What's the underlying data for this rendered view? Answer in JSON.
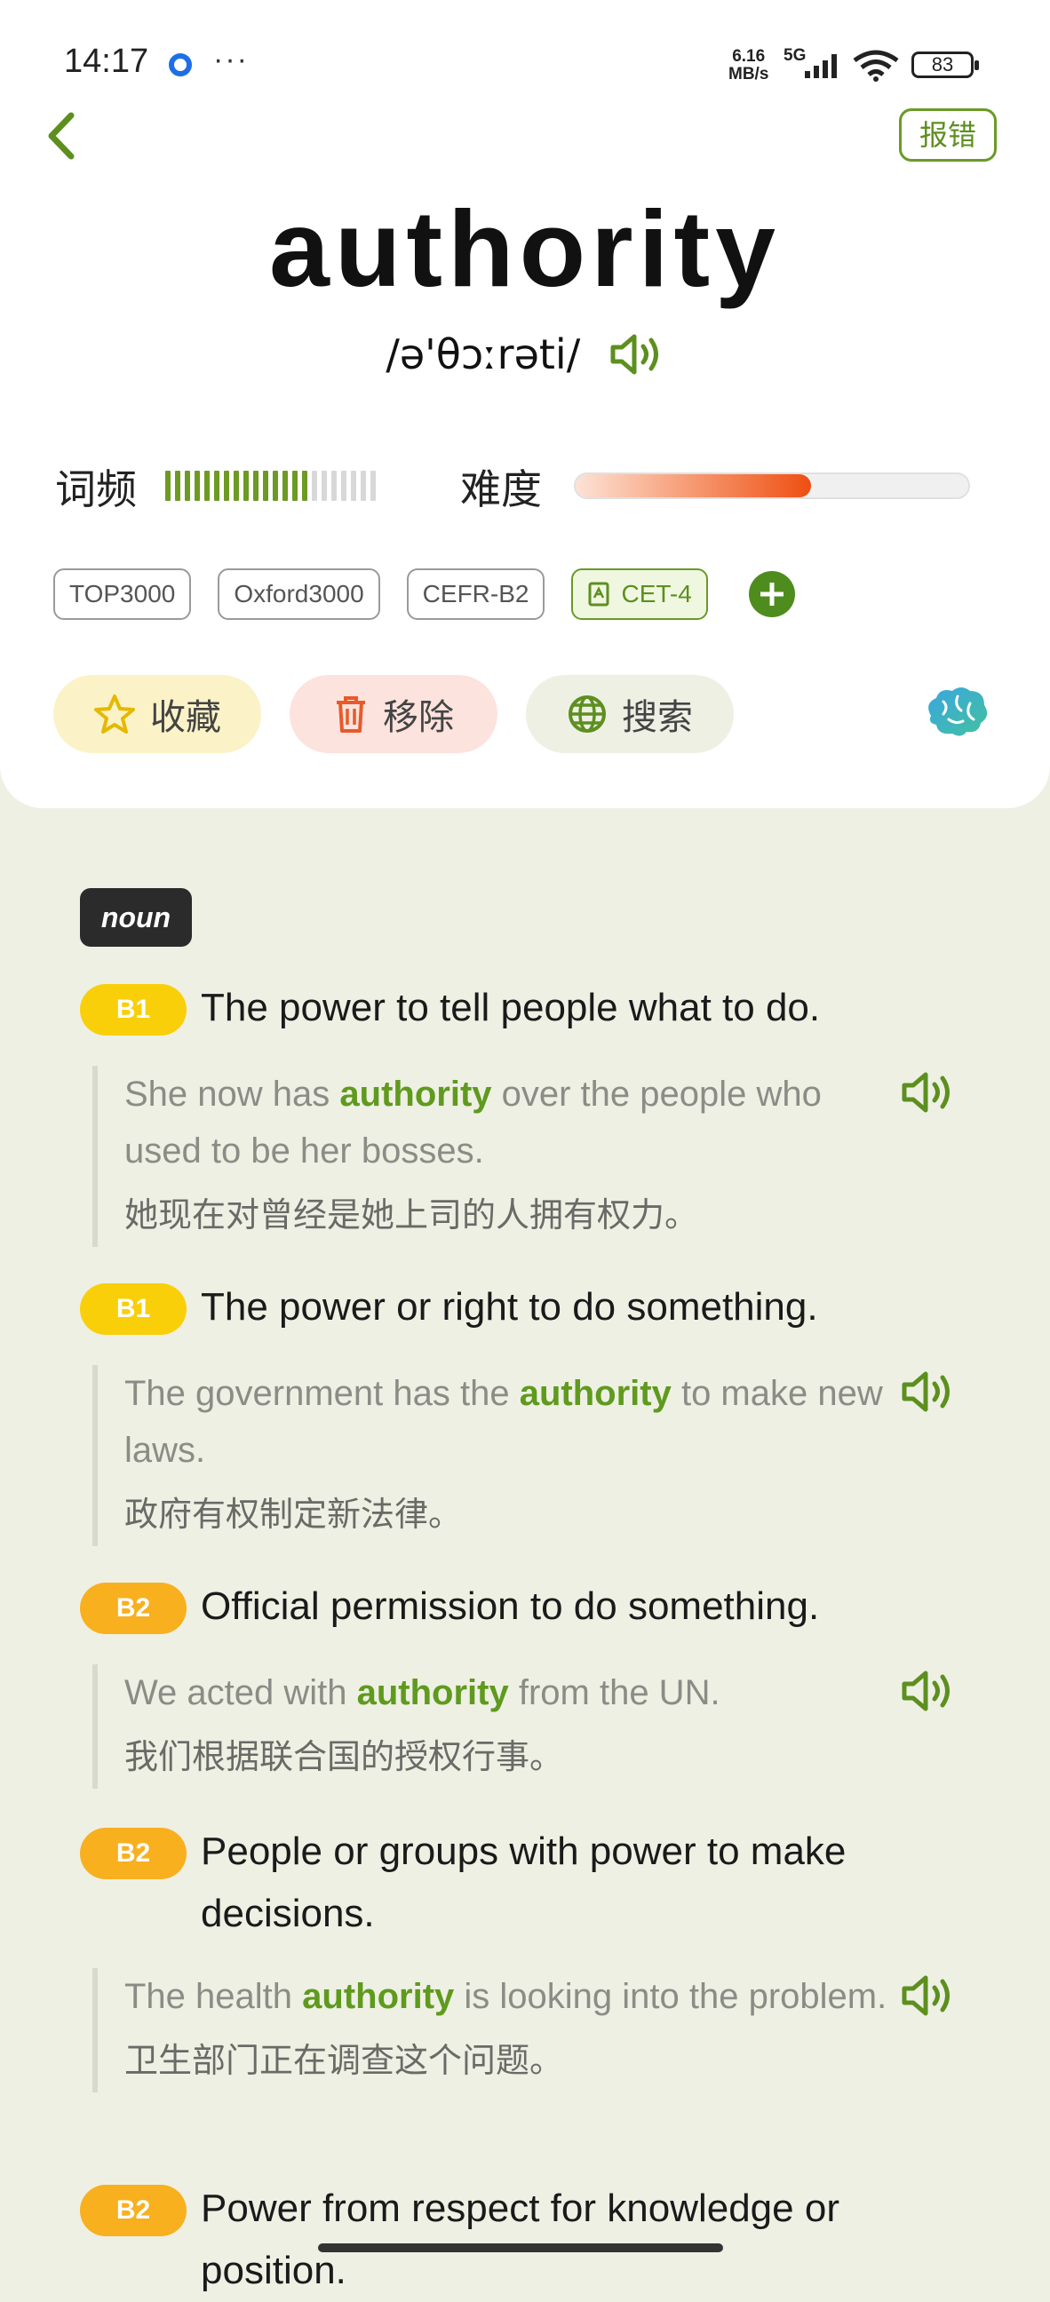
{
  "status_bar": {
    "time": "14:17",
    "more": "···",
    "net_speed_value": "6.16",
    "net_speed_unit": "MB/s",
    "network": "5G",
    "battery": "83"
  },
  "header": {
    "back_icon": "chevron-left-icon",
    "report_label": "报错",
    "word": "authority",
    "phonetic": "/ə'θɔːrəti/",
    "frequency_label": "词频",
    "frequency_level": 0.68,
    "difficulty_label": "难度",
    "difficulty_level": 0.6,
    "tags": [
      "TOP3000",
      "Oxford3000",
      "CEFR-B2"
    ],
    "active_tag": "CET-4",
    "actions": {
      "favorite_label": "收藏",
      "remove_label": "移除",
      "search_label": "搜索"
    }
  },
  "definitions": {
    "part_of_speech": "noun",
    "senses": [
      {
        "level": "B1",
        "definition": "The power to tell people what to do.",
        "example_before": "She now has ",
        "example_keyword": "authority",
        "example_after": " over the people who used to be her bosses.",
        "translation": "她现在对曾经是她上司的人拥有权力。"
      },
      {
        "level": "B1",
        "definition": "The power or right to do something.",
        "example_before": "The government has the ",
        "example_keyword": "authority",
        "example_after": " to make new laws.",
        "translation": "政府有权制定新法律。"
      },
      {
        "level": "B2",
        "definition": "Official permission to do something.",
        "example_before": "We acted with ",
        "example_keyword": "authority",
        "example_after": " from the UN.",
        "translation": "我们根据联合国的授权行事。"
      },
      {
        "level": "B2",
        "definition": "People or groups with power to make decisions.",
        "example_before": "The health ",
        "example_keyword": "authority",
        "example_after": " is looking into the problem.",
        "translation": "卫生部门正在调查这个问题。"
      },
      {
        "level": "B2",
        "definition": "Power from respect for knowledge or position."
      }
    ]
  },
  "colors": {
    "accent_green": "#5f9a1e",
    "level_b1": "#f9cf0a",
    "level_b2": "#f8b01f",
    "difficulty": "#ee4f12",
    "background": "#eef0e4"
  }
}
